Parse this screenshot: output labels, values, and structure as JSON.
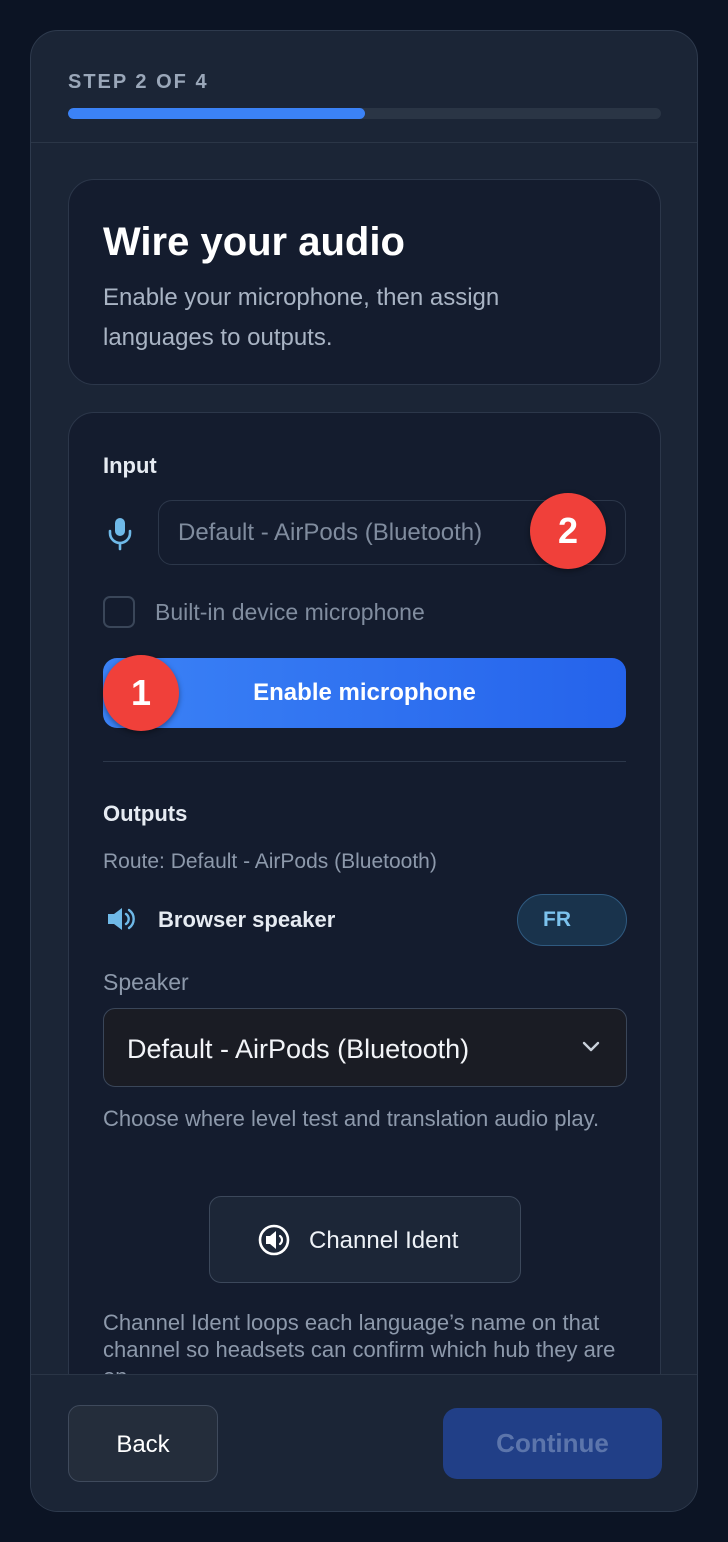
{
  "step": {
    "label": "STEP 2 OF 4",
    "progress": 0.5
  },
  "intro": {
    "title": "Wire your audio",
    "subtitle": "Enable your microphone, then assign languages to outputs."
  },
  "input": {
    "section_label": "Input",
    "mic_device": "Default - AirPods (Bluetooth)",
    "builtin_checkbox_label": "Built-in device microphone",
    "builtin_checked": false,
    "enable_button_label": "Enable microphone"
  },
  "annotations": {
    "badge_1": "1",
    "badge_2": "2"
  },
  "outputs": {
    "section_label": "Outputs",
    "route_text": "Route: Default - AirPods (Bluetooth)",
    "output_name": "Browser speaker",
    "language": "FR",
    "speaker_label": "Speaker",
    "speaker_selected": "Default - AirPods (Bluetooth)",
    "speaker_help": "Choose where level test and translation audio play.",
    "channel_ident_label": "Channel Ident",
    "channel_ident_desc": "Channel Ident loops each language’s name on that channel so headsets can confirm which hub they are on."
  },
  "footer": {
    "back_label": "Back",
    "continue_label": "Continue"
  },
  "colors": {
    "accent": "#3b82f6",
    "badge": "#f0403a",
    "background": "#0c1424",
    "card": "#141c2e"
  },
  "icons": {
    "mic": "microphone-icon",
    "speaker": "speaker-icon",
    "chevron": "chevron-down-icon",
    "channel_ident": "channel-ident-icon"
  }
}
